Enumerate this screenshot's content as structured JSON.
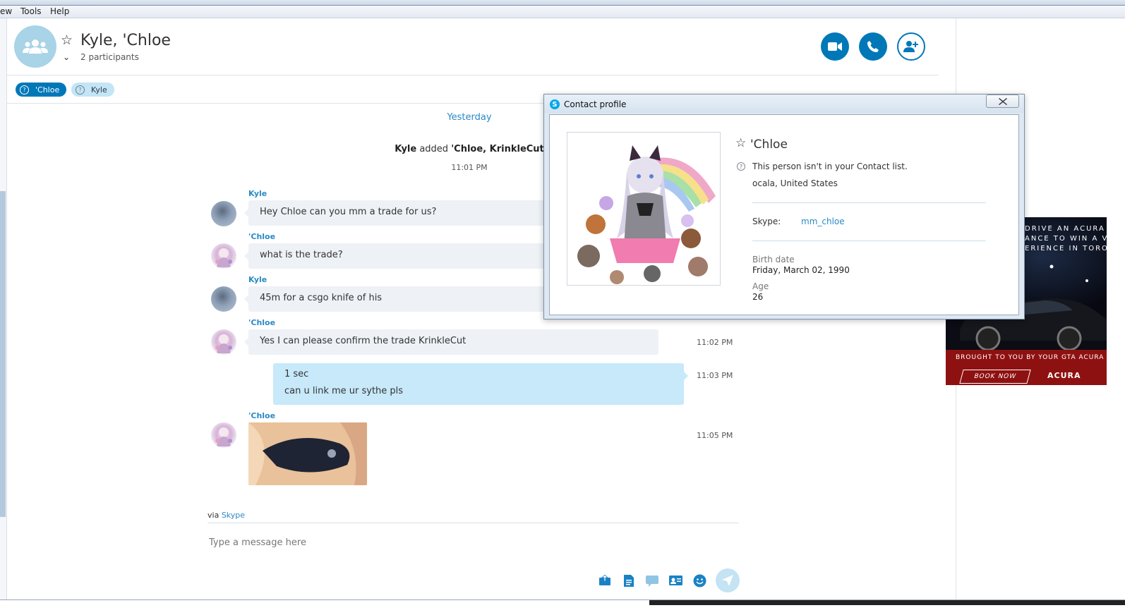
{
  "menu": {
    "items": [
      "ew",
      "Tools",
      "Help"
    ]
  },
  "conversation": {
    "title": "Kyle, 'Chloe",
    "participants_label": "2 participants",
    "pills": [
      {
        "label": "'Chloe",
        "active": true
      },
      {
        "label": "Kyle",
        "active": false
      }
    ]
  },
  "chat": {
    "day_divider": "Yesterday",
    "system_message": {
      "actor": "Kyle",
      "verb": " added ",
      "targets": "'Chloe, KrinkleCut",
      "time": "11:01 PM"
    },
    "messages": [
      {
        "sender": "Kyle",
        "text": "Hey Chloe can you mm a trade for us?"
      },
      {
        "sender": "'Chloe",
        "text": "what is the trade?"
      },
      {
        "sender": "Kyle",
        "text": "45m for a csgo knife of his"
      },
      {
        "sender": "'Chloe",
        "text": "Yes I can please confirm the trade KrinkleCut",
        "time": "11:02 PM"
      },
      {
        "sender": "",
        "lines": [
          "1 sec",
          "can u link me ur sythe pls"
        ],
        "time": "11:03 PM"
      },
      {
        "sender": "'Chloe",
        "image": true,
        "time": "11:05 PM"
      }
    ]
  },
  "composer": {
    "via_prefix": "via ",
    "via_link": "Skype",
    "placeholder": "Type a message here",
    "tools": [
      "send-file-icon",
      "document-icon",
      "video-message-icon",
      "contact-card-icon",
      "emoticon-icon",
      "send-icon"
    ]
  },
  "contact_profile": {
    "window_title": "Contact profile",
    "name": "'Chloe",
    "status": "This person isn't in your Contact list.",
    "location": "ocala, United States",
    "skype_label": "Skype:",
    "skype_value": "mm_chloe",
    "birth_label": "Birth date",
    "birth_value": "Friday, March 02, 1990",
    "age_label": "Age",
    "age_value": "26"
  },
  "ad": {
    "lines": [
      "DRIVE AN ACURA",
      "ANCE TO WIN A V",
      "ERIENCE IN TORO"
    ],
    "footer": "BROUGHT TO YOU BY YOUR GTA ACURA",
    "cta": "BOOK NOW",
    "brand": "ACURA"
  },
  "colors": {
    "accent": "#0078b8",
    "link": "#2a8ac4",
    "my_bubble": "#c7e9fa",
    "their_bubble": "#eef2f6"
  }
}
